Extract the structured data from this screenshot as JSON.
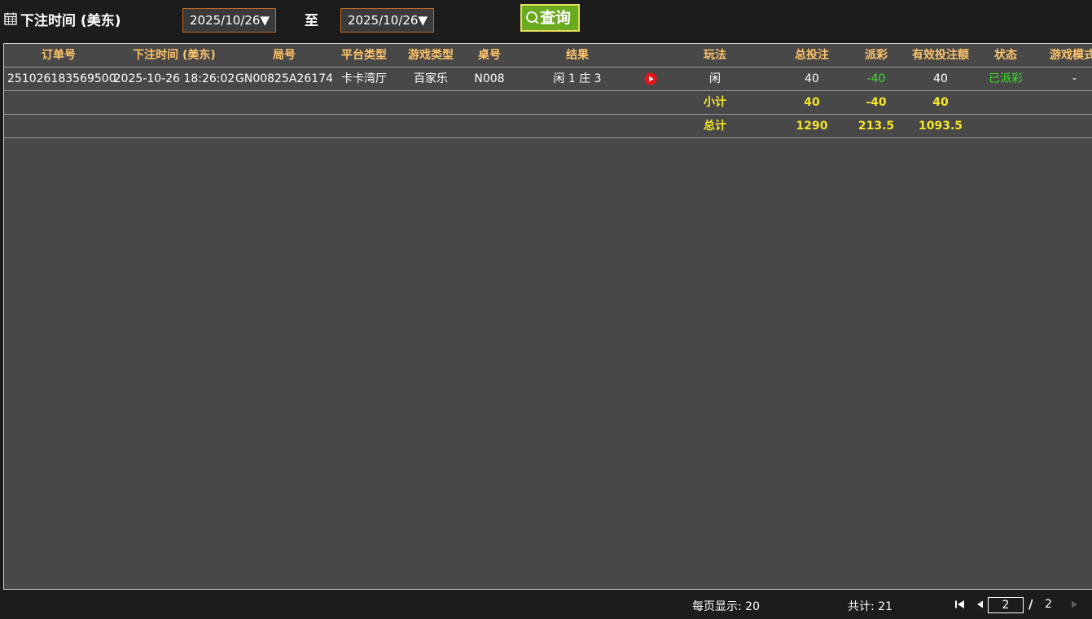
{
  "filter": {
    "label": "下注时间 (美东)",
    "from_date": "2025/10/26▼",
    "to_label": "至",
    "to_date": "2025/10/26▼",
    "query_label": "查询"
  },
  "table": {
    "columns": [
      "订单号",
      "下注时间 (美东)",
      "局号",
      "平台类型",
      "游戏类型",
      "桌号",
      "结果",
      "",
      "玩法",
      "总投注",
      "派彩",
      "有效投注额",
      "状态",
      "游戏模式"
    ],
    "rows": [
      {
        "order_no": "251026183569500",
        "bet_time": "2025-10-26 18:26:02",
        "round_no": "GN00825A26174",
        "platform": "卡卡湾厅",
        "game_type": "百家乐",
        "table_no": "N008",
        "result": "闲 1 庄 3",
        "play": "闲",
        "total_bet": "40",
        "payout": "-40",
        "valid_bet": "40",
        "status": "已派彩",
        "mode": "-"
      }
    ],
    "subtotal": {
      "label": "小计",
      "total_bet": "40",
      "payout": "-40",
      "valid_bet": "40"
    },
    "total": {
      "label": "总计",
      "total_bet": "1290",
      "payout": "213.5",
      "valid_bet": "1093.5"
    }
  },
  "footer": {
    "per_page": "每页显示: 20",
    "total_count": "共计: 21",
    "current_page": "2",
    "slash": "/",
    "total_pages": "2"
  },
  "colors": {
    "header_text": "#ffc46a",
    "summary_text": "#f5e627",
    "positive_status": "#3ddc2f",
    "query_button": "#6aaa1e",
    "date_border": "#c8691e"
  }
}
